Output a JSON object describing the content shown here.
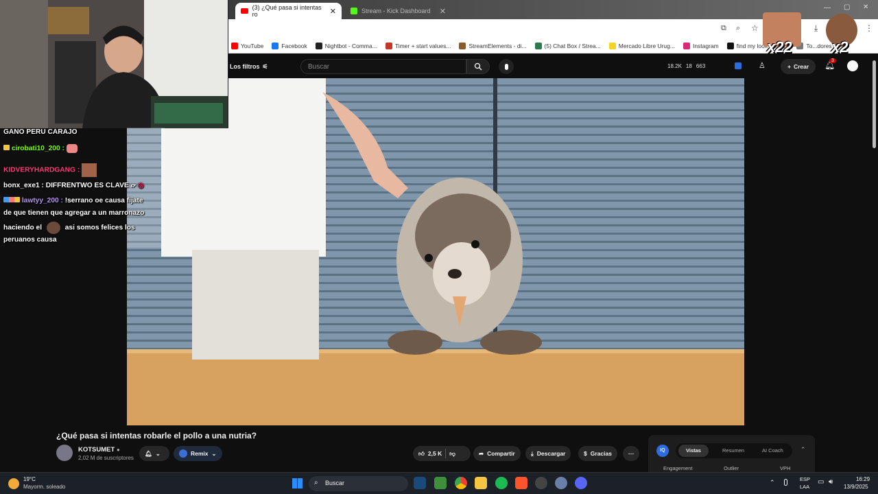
{
  "browser": {
    "tabs": [
      {
        "label": "(3) ¿Qué pasa si intentas ro"
      },
      {
        "label": "Stream - Kick Dashboard"
      }
    ],
    "bookmarks": [
      {
        "label": "YouTube",
        "color": "#ff0000"
      },
      {
        "label": "Facebook",
        "color": "#1877f2"
      },
      {
        "label": "Nightbot - Comma...",
        "color": "#222222"
      },
      {
        "label": "Timer + start values...",
        "color": "#c0392b"
      },
      {
        "label": "StreamElements - di...",
        "color": "#8a5a2b"
      },
      {
        "label": "(5) Chat Box / Strea...",
        "color": "#2a7a4b"
      },
      {
        "label": "Mercado Libre Urug...",
        "color": "#f3d324"
      },
      {
        "label": "Instagram",
        "color": "#d62976"
      },
      {
        "label": "find my look-a-like...",
        "color": "#111111"
      },
      {
        "label": "To...dores",
        "color": "#777777"
      }
    ]
  },
  "overlay": {
    "combo1": "x22",
    "combo2": "x2"
  },
  "youtube": {
    "filters_label": "Los filtros",
    "search_placeholder": "Buscar",
    "stats": [
      "18.2K",
      "18",
      "663"
    ],
    "create_label": "Crear",
    "notif_count": "3"
  },
  "chat": [
    {
      "user": "",
      "text": "GANO PERU CARAJO",
      "user_color": "#ffffff"
    },
    {
      "user": "cirobati10_200 :",
      "text": "",
      "user_color": "#7CFC00"
    },
    {
      "user": "KIDVERYHARDGANG :",
      "text": "",
      "user_color": "#ff3a7a"
    },
    {
      "user": "bonx_exe1 :",
      "text": "DIFFRENTWO ES CLAVE",
      "user_color": "#ffffff"
    },
    {
      "user": "lawtyy_200 :",
      "text": "!serrano oe causa fijate",
      "user_color": "#b794f6"
    },
    {
      "user": "",
      "text": "de que tienen que agregar a un marronazo",
      "user_color": "#ffffff"
    },
    {
      "user": "",
      "text": "haciendo el",
      "user_color": "#ffffff"
    },
    {
      "user": "",
      "text": "asi somos felices los",
      "user_color": "#ffffff"
    },
    {
      "user": "",
      "text": "peruanos causa",
      "user_color": "#ffffff"
    }
  ],
  "video": {
    "title": "¿Qué pasa si intentas robarle el pollo a una nutria?",
    "channel": "KOTSUMET",
    "subscribers": "2,02 M de suscriptores",
    "remix_label": "Remix",
    "likes": "2,5 K",
    "share_label": "Compartir",
    "download_label": "Descargar",
    "thanks_label": "Gracias"
  },
  "vidiq": {
    "tabs": [
      "Vistas",
      "Resumen",
      "AI Coach"
    ],
    "columns": [
      "Engagement",
      "Outlier",
      "VPH"
    ]
  },
  "taskbar": {
    "weather_temp": "19°C",
    "weather_desc": "Mayorm. soleado",
    "search_label": "Buscar",
    "lang1": "ESP",
    "lang2": "LAA",
    "time": "16:29",
    "date": "13/9/2025"
  }
}
